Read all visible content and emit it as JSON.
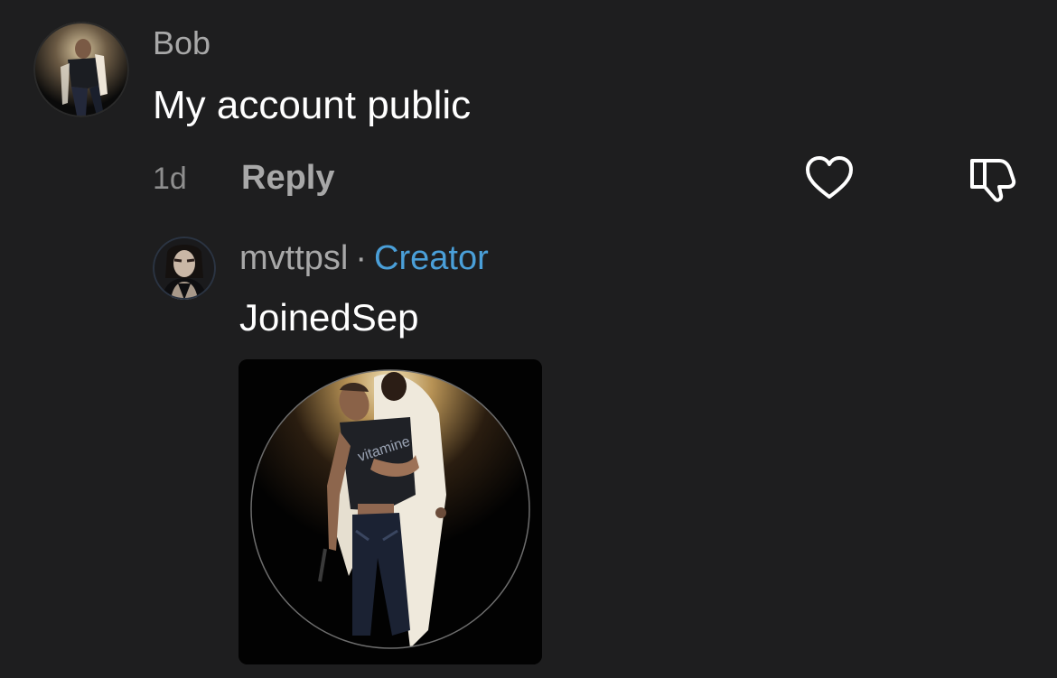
{
  "comment": {
    "username": "Bob",
    "text": "My account public",
    "time": "1d",
    "reply_label": "Reply",
    "like_icon": "heart-outline-icon",
    "dislike_icon": "thumbs-down-outline-icon"
  },
  "reply": {
    "username": "mvttpsl",
    "separator": "·",
    "badge": "Creator",
    "text": "JoinedSep",
    "image_text": "vitamine"
  },
  "colors": {
    "background": "#1e1e1f",
    "secondary_text": "#a8a8a8",
    "creator_badge": "#4a9fd8",
    "primary_text": "#ffffff"
  }
}
